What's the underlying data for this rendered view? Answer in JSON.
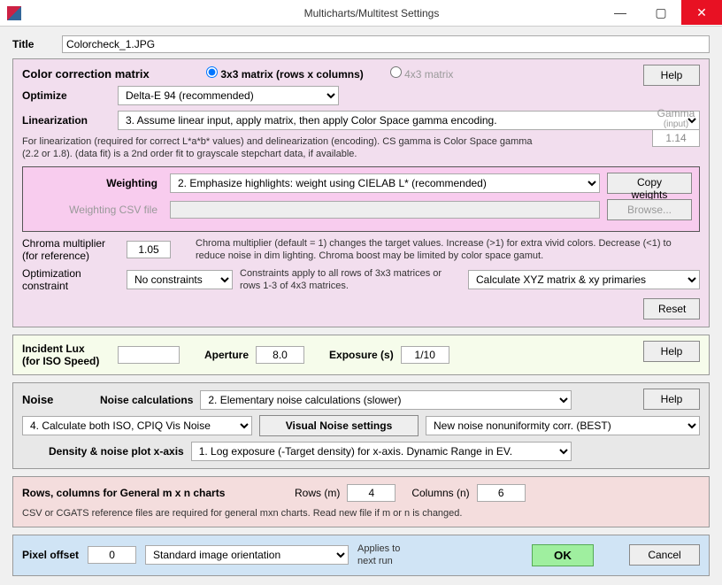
{
  "window": {
    "title": "Multicharts/Multitest Settings",
    "min": "—",
    "max": "▢",
    "close": "✕"
  },
  "title_section": {
    "label": "Title",
    "value": "Colorcheck_1.JPG"
  },
  "ccm": {
    "heading": "Color correction matrix",
    "matrix3x3": "3x3 matrix  (rows x columns)",
    "matrix4x3": "4x3 matrix",
    "help": "Help",
    "optimize_label": "Optimize",
    "optimize_value": "Delta-E 94  (recommended)",
    "linearization_label": "Linearization",
    "linearization_value": "3.  Assume linear input, apply matrix, then apply Color Space gamma encoding.",
    "lin_note": "For linearization (required for correct L*a*b* values) and delinearization (encoding). CS gamma is Color Space gamma (2.2 or 1.8). (data fit) is a 2nd order fit to grayscale stepchart data, if available.",
    "gamma_label": "Gamma",
    "gamma_sub": "(input)",
    "gamma_value": "1.14",
    "weighting_label": "Weighting",
    "weighting_value": "2.  Emphasize highlights: weight using CIELAB L*  (recommended)",
    "copy_weights": "Copy weights",
    "weighting_csv_label": "Weighting CSV file",
    "browse": "Browse...",
    "chroma_label1": "Chroma multiplier",
    "chroma_label2": "(for reference)",
    "chroma_value": "1.05",
    "chroma_note": "Chroma multiplier (default = 1) changes the target values. Increase (>1) for extra vivid colors. Decrease (<1) to reduce noise in dim lighting. Chroma boost may be limited by color space gamut.",
    "opt_constraint_label1": "Optimization",
    "opt_constraint_label2": "constraint",
    "opt_constraint_value": "No constraints",
    "opt_constraint_note": "Constraints apply to all rows of 3x3 matrices or rows 1-3 of 4x3 matrices.",
    "calc_xyz": "Calculate XYZ matrix & xy primaries",
    "reset": "Reset"
  },
  "lux": {
    "label1": "Incident Lux",
    "label2": "(for ISO Speed)",
    "value": "",
    "aperture_label": "Aperture",
    "aperture_value": "8.0",
    "exposure_label": "Exposure (s)",
    "exposure_value": "1/10",
    "help": "Help"
  },
  "noise": {
    "heading": "Noise",
    "calc_label": "Noise calculations",
    "calc_value": "2. Elementary noise calculations (slower)",
    "help": "Help",
    "iso_value": "4.  Calculate both ISO, CPIQ Vis Noise",
    "visual_settings": "Visual Noise settings",
    "nonuniform_value": "New noise nonuniformity corr. (BEST)",
    "density_label": "Density & noise plot x-axis",
    "density_value": "1. Log exposure (-Target density) for x-axis.     Dynamic Range in EV."
  },
  "mxn": {
    "heading": "Rows, columns for General m x n charts",
    "rows_label": "Rows (m)",
    "rows_value": "4",
    "cols_label": "Columns (n)",
    "cols_value": "6",
    "note": "CSV or CGATS reference files are required for general mxn charts.  Read new file if m or n is changed."
  },
  "bottom": {
    "pixel_offset_label": "Pixel offset",
    "pixel_offset_value": "0",
    "orientation_value": "Standard image orientation",
    "applies1": "Applies to",
    "applies2": "next run",
    "ok": "OK",
    "cancel": "Cancel"
  }
}
